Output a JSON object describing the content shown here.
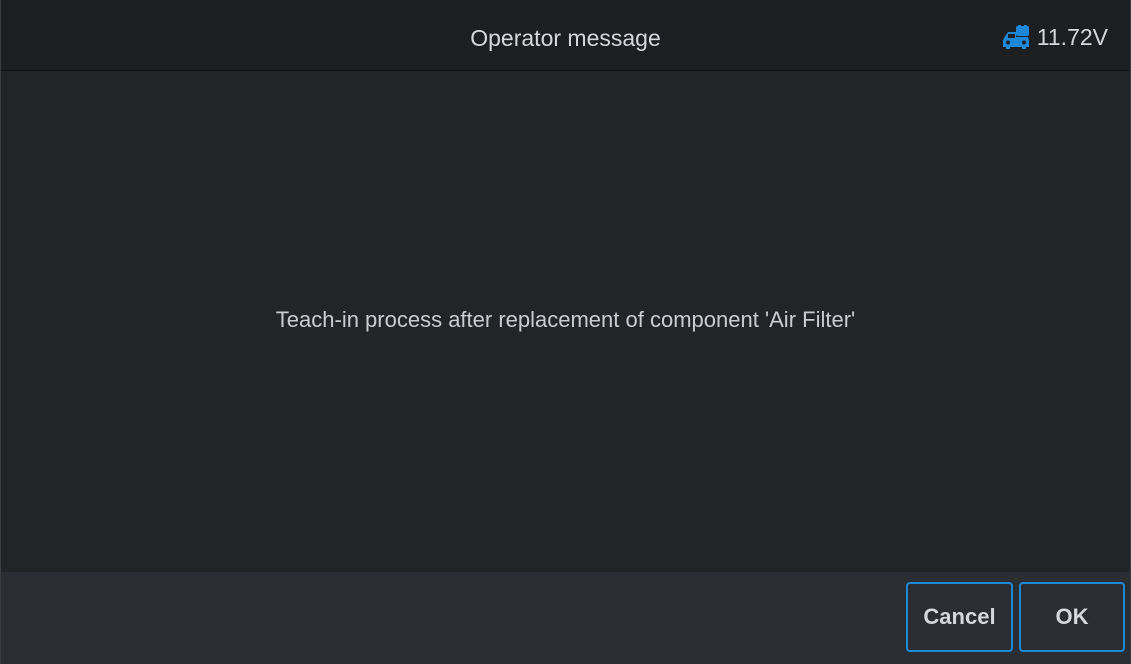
{
  "header": {
    "title": "Operator message",
    "battery_icon": "car-battery-icon",
    "voltage": "11.72V",
    "accent_color": "#1e88d8"
  },
  "main": {
    "message": "Teach-in process after replacement of component 'Air Filter'"
  },
  "footer": {
    "cancel_label": "Cancel",
    "ok_label": "OK"
  }
}
